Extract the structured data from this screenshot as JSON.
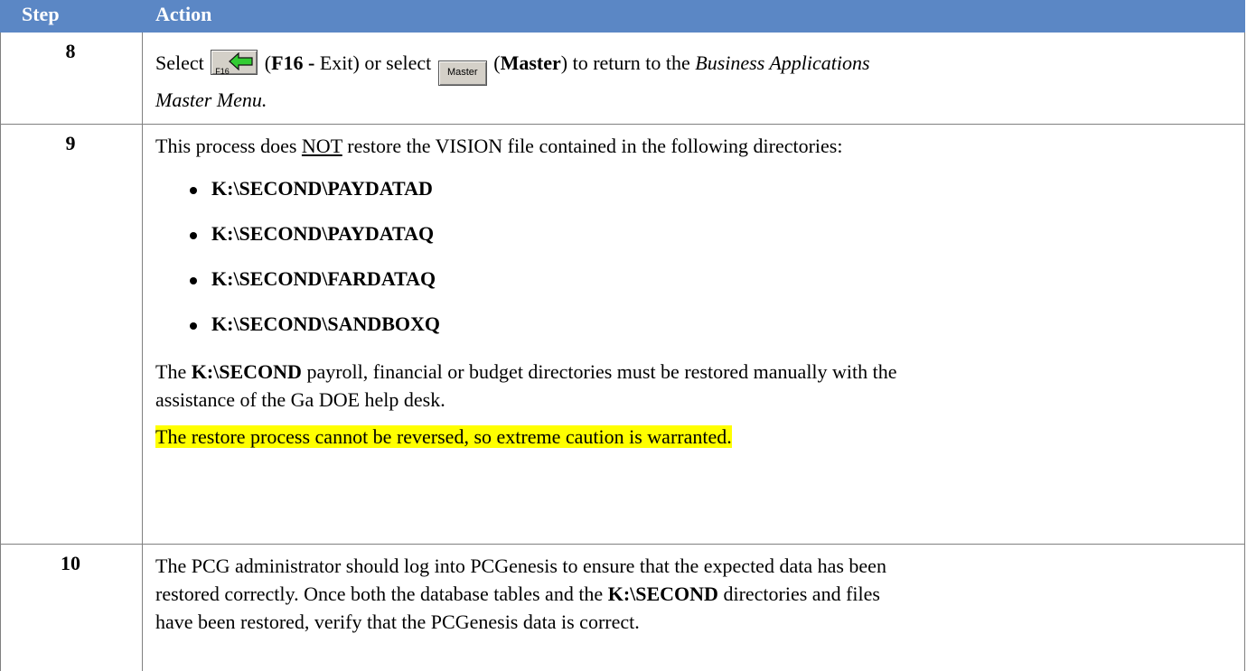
{
  "header": {
    "step": "Step",
    "action": "Action"
  },
  "rows": {
    "r8": {
      "step": "8",
      "select1": "Select",
      "f16_key": "F16",
      "f16_text_bold": "F16 -",
      "f16_text": " Exit) or select ",
      "master_btn": "Master",
      "master_bold": "Master",
      "return_text": ") to return to the ",
      "italic1": "Business Applications",
      "italic2": "Master Menu."
    },
    "r9": {
      "step": "9",
      "intro_pre": "This process does ",
      "intro_u": "NOT",
      "intro_post": " restore the VISION file contained in the following directories:",
      "dirs": [
        "K:\\SECOND\\PAYDATAD",
        "K:\\SECOND\\PAYDATAQ",
        "K:\\SECOND\\FARDATAQ",
        "K:\\SECOND\\SANDBOXQ"
      ],
      "note_pre": "The ",
      "note_bold": "K:\\SECOND",
      "note_post": " payroll, financial or budget directories must be restored manually with the",
      "note_line2": "assistance of the Ga DOE help desk.",
      "warning": "The restore process cannot be reversed, so extreme caution is warranted."
    },
    "r10": {
      "step": "10",
      "line1": "The PCG administrator should log into PCGenesis to ensure that the expected data has been",
      "line2_pre": "restored correctly.  Once both the database tables and the ",
      "line2_bold": "K:\\SECOND",
      "line2_post": " directories and files",
      "line3": "have been restored, verify that the PCGenesis data is correct."
    }
  },
  "colors": {
    "header_bg": "#5b87c5",
    "highlight": "#ffff00"
  }
}
